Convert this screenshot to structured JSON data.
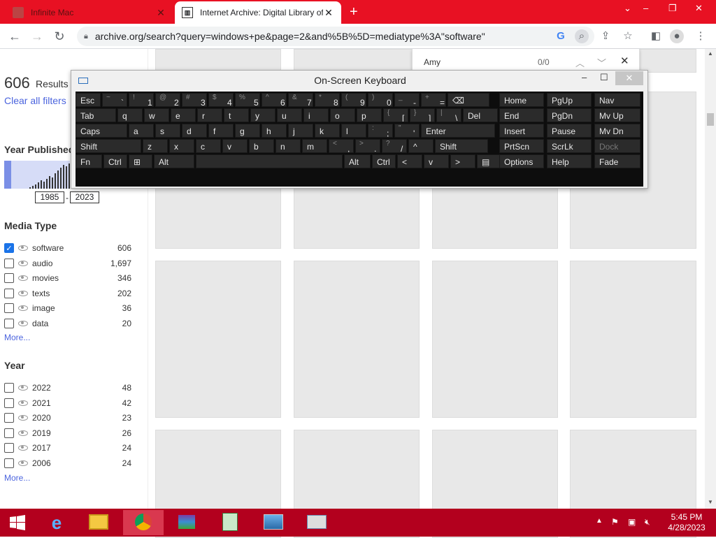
{
  "browser": {
    "tabs": [
      {
        "title": "Infinite Mac",
        "active": false
      },
      {
        "title": "Internet Archive: Digital Library of",
        "active": true
      }
    ],
    "url": "archive.org/search?query=windows+pe&page=2&and%5B%5D=mediatype%3A\"software\"",
    "find": {
      "query": "Amy",
      "count": "0/0"
    }
  },
  "sidebar": {
    "results_count": "606",
    "results_label": "Results",
    "clear_filters": "Clear all filters",
    "year_published_title": "Year Published",
    "year_range": {
      "from": "1985",
      "to": "2023"
    },
    "histogram": [
      2,
      4,
      6,
      9,
      12,
      10,
      14,
      18,
      16,
      22,
      26,
      30,
      34,
      32,
      36
    ],
    "media_type_title": "Media Type",
    "media_types": [
      {
        "label": "software",
        "count": "606",
        "checked": true
      },
      {
        "label": "audio",
        "count": "1,697",
        "checked": false
      },
      {
        "label": "movies",
        "count": "346",
        "checked": false
      },
      {
        "label": "texts",
        "count": "202",
        "checked": false
      },
      {
        "label": "image",
        "count": "36",
        "checked": false
      },
      {
        "label": "data",
        "count": "20",
        "checked": false
      }
    ],
    "media_more": "More...",
    "year_title": "Year",
    "years": [
      {
        "label": "2022",
        "count": "48"
      },
      {
        "label": "2021",
        "count": "42"
      },
      {
        "label": "2020",
        "count": "23"
      },
      {
        "label": "2019",
        "count": "26"
      },
      {
        "label": "2017",
        "count": "24"
      },
      {
        "label": "2006",
        "count": "24"
      }
    ],
    "year_more": "More..."
  },
  "osk": {
    "title": "On-Screen Keyboard",
    "rows": [
      [
        {
          "m": "Esc"
        },
        {
          "s": "~",
          "m": "`"
        },
        {
          "s": "!",
          "m": "1"
        },
        {
          "s": "@",
          "m": "2"
        },
        {
          "s": "#",
          "m": "3"
        },
        {
          "s": "$",
          "m": "4"
        },
        {
          "s": "%",
          "m": "5"
        },
        {
          "s": "^",
          "m": "6"
        },
        {
          "s": "&",
          "m": "7"
        },
        {
          "s": "*",
          "m": "8"
        },
        {
          "s": "(",
          "m": "9"
        },
        {
          "s": ")",
          "m": "0"
        },
        {
          "s": "_",
          "m": "-"
        },
        {
          "s": "+",
          "m": "="
        },
        {
          "m": "⌫"
        }
      ],
      [
        {
          "m": "Tab"
        },
        {
          "m": "q"
        },
        {
          "m": "w"
        },
        {
          "m": "e"
        },
        {
          "m": "r"
        },
        {
          "m": "t"
        },
        {
          "m": "y"
        },
        {
          "m": "u"
        },
        {
          "m": "i"
        },
        {
          "m": "o"
        },
        {
          "m": "p"
        },
        {
          "s": "{",
          "m": "["
        },
        {
          "s": "}",
          "m": "]"
        },
        {
          "s": "|",
          "m": "\\"
        },
        {
          "m": "Del"
        }
      ],
      [
        {
          "m": "Caps"
        },
        {
          "m": "a"
        },
        {
          "m": "s"
        },
        {
          "m": "d"
        },
        {
          "m": "f"
        },
        {
          "m": "g"
        },
        {
          "m": "h"
        },
        {
          "m": "j"
        },
        {
          "m": "k"
        },
        {
          "m": "l"
        },
        {
          "s": ":",
          "m": ";"
        },
        {
          "s": "\"",
          "m": "'"
        },
        {
          "m": "Enter"
        }
      ],
      [
        {
          "m": "Shift"
        },
        {
          "m": "z"
        },
        {
          "m": "x"
        },
        {
          "m": "c"
        },
        {
          "m": "v"
        },
        {
          "m": "b"
        },
        {
          "m": "n"
        },
        {
          "m": "m"
        },
        {
          "s": "<",
          "m": ","
        },
        {
          "s": ">",
          "m": "."
        },
        {
          "s": "?",
          "m": "/"
        },
        {
          "m": "^"
        },
        {
          "m": "Shift"
        }
      ],
      [
        {
          "m": "Fn"
        },
        {
          "m": "Ctrl"
        },
        {
          "m": "⊞"
        },
        {
          "m": "Alt"
        },
        {
          "m": ""
        },
        {
          "m": "Alt"
        },
        {
          "m": "Ctrl"
        },
        {
          "m": "<"
        },
        {
          "m": "v"
        },
        {
          "m": ">"
        },
        {
          "m": "▤"
        }
      ]
    ],
    "nav": [
      [
        "Home",
        "PgUp",
        "Nav"
      ],
      [
        "End",
        "PgDn",
        "Mv Up"
      ],
      [
        "Insert",
        "Pause",
        "Mv Dn"
      ],
      [
        "PrtScn",
        "ScrLk",
        "Dock"
      ],
      [
        "Options",
        "Help",
        "Fade"
      ]
    ]
  },
  "taskbar": {
    "apps": [
      "internet-explorer",
      "file-explorer",
      "chrome",
      "winrar",
      "notepad-editor",
      "photo-viewer",
      "on-screen-keyboard"
    ],
    "time": "5:45 PM",
    "date": "4/28/2023"
  }
}
